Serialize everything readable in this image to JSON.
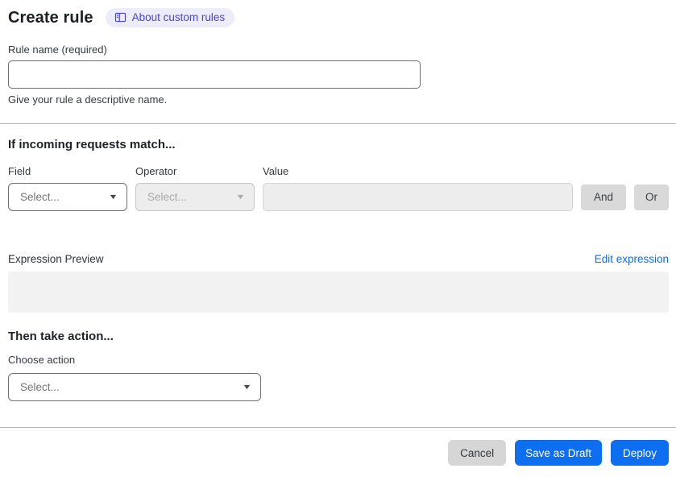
{
  "header": {
    "title": "Create rule",
    "about_badge": "About custom rules"
  },
  "rule_name": {
    "label": "Rule name (required)",
    "value": "",
    "helper": "Give your rule a descriptive name."
  },
  "match_section": {
    "heading": "If incoming requests match...",
    "field": {
      "label": "Field",
      "selected": "Select..."
    },
    "operator": {
      "label": "Operator",
      "selected": "Select...",
      "state": "disabled"
    },
    "value": {
      "label": "Value",
      "value": "",
      "state": "disabled"
    },
    "and_button": "And",
    "or_button": "Or"
  },
  "expression": {
    "label": "Expression Preview",
    "edit_link": "Edit expression",
    "preview_content": ""
  },
  "action_section": {
    "heading": "Then take action...",
    "choose_label": "Choose action",
    "selected": "Select..."
  },
  "footer": {
    "cancel": "Cancel",
    "save_draft": "Save as Draft",
    "deploy": "Deploy"
  },
  "icons": {
    "badge_icon": "book-icon",
    "caret_down_glyph": "▼"
  },
  "colors": {
    "accent_blue": "#0d6ef0",
    "link_blue": "#0d6ce8",
    "badge_bg": "#edecfa",
    "badge_text": "#4a46cf",
    "divider": "#b3b3b3",
    "disabled_bg": "#ededed",
    "chip_bg": "#d9d9d9",
    "preview_bg": "#f2f2f2"
  }
}
